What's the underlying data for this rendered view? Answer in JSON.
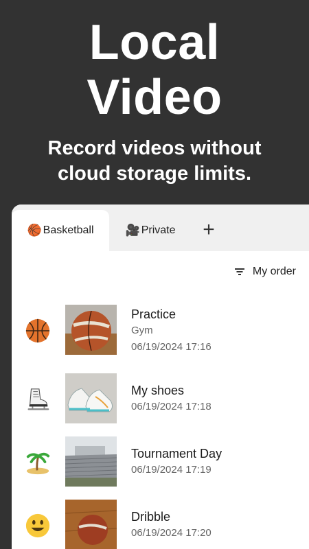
{
  "hero": {
    "title_line1": "Local",
    "title_line2": "Video",
    "subtitle_line1": "Record videos without",
    "subtitle_line2": "cloud storage limits."
  },
  "tabs": [
    {
      "emoji": "🏀",
      "label": "Basketball",
      "active": true
    },
    {
      "emoji": "🎥",
      "label": "Private",
      "active": false
    }
  ],
  "add_tab_label": "+",
  "sort": {
    "label": "My order",
    "icon": "sort-icon"
  },
  "videos": [
    {
      "title": "Practice",
      "subtitle": "Gym",
      "date": "06/19/2024 17:16",
      "emoji": "basketball",
      "thumb": "basketball"
    },
    {
      "title": "My shoes",
      "subtitle": "",
      "date": "06/19/2024 17:18",
      "emoji": "ice-skate",
      "thumb": "shoes"
    },
    {
      "title": "Tournament Day",
      "subtitle": "",
      "date": "06/19/2024 17:19",
      "emoji": "island",
      "thumb": "building"
    },
    {
      "title": "Dribble",
      "subtitle": "",
      "date": "06/19/2024 17:20",
      "emoji": "smiley",
      "thumb": "ball-floor"
    }
  ],
  "colors": {
    "background": "#323232",
    "panel": "#ffffff",
    "tabbar": "#f0f0f0"
  }
}
